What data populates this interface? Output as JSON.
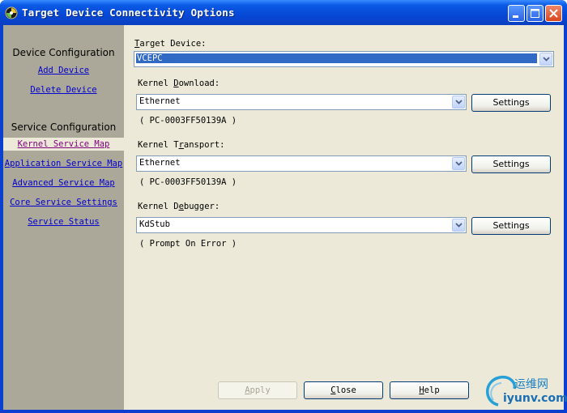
{
  "window": {
    "title": "Target Device Connectivity Options"
  },
  "sidebar": {
    "device_heading": "Device Configuration",
    "device_links": [
      "Add Device",
      "Delete Device"
    ],
    "service_heading": "Service Configuration",
    "service_links": [
      "Kernel Service Map",
      "Application Service Map",
      "Advanced Service Map",
      "Core Service Settings",
      "Service Status"
    ],
    "active_link": "Kernel Service Map"
  },
  "main": {
    "target_device": {
      "label_pre": "",
      "label_key": "T",
      "label_post": "arget Device:",
      "value": "VCEPC"
    },
    "kernel_download": {
      "label_pre": "Kernel ",
      "label_key": "D",
      "label_post": "ownload:",
      "value": "Ethernet",
      "settings": "Settings",
      "info": "( PC-0003FF50139A )"
    },
    "kernel_transport": {
      "label_pre": "Kernel T",
      "label_key": "r",
      "label_post": "ansport:",
      "value": "Ethernet",
      "settings": "Settings",
      "info": "( PC-0003FF50139A )"
    },
    "kernel_debugger": {
      "label_pre": "Kernel D",
      "label_key": "e",
      "label_post": "bugger:",
      "value": "KdStub",
      "settings": "Settings",
      "info": "( Prompt On Error )"
    }
  },
  "footer": {
    "apply": {
      "key": "A",
      "rest": "pply"
    },
    "close": {
      "key": "C",
      "rest": "lose"
    },
    "help": {
      "key": "H",
      "rest": "elp"
    }
  },
  "watermark": {
    "cn": "运维网",
    "url": "iyunv.com"
  },
  "colors": {
    "sidebar_bg": "#aca899",
    "dialog_bg": "#ece9d8",
    "link": "#0000cc",
    "active_link": "#800080",
    "selection": "#316ac5"
  }
}
